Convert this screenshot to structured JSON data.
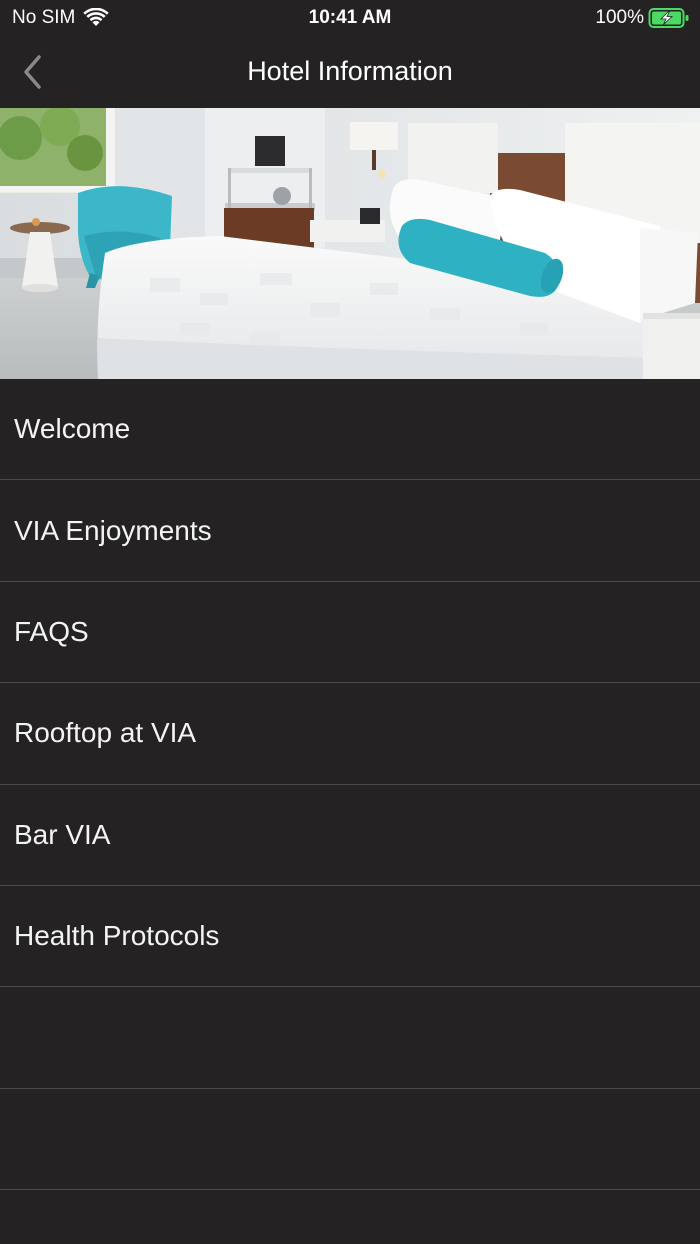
{
  "status_bar": {
    "carrier": "No SIM",
    "time": "10:41 AM",
    "battery_percent": "100%",
    "battery_level": 1.0,
    "charging": true,
    "icons": [
      "wifi-icon",
      "battery-charging-icon"
    ]
  },
  "nav": {
    "title": "Hotel Information",
    "back_icon": "chevron-left-icon"
  },
  "hero": {
    "image": "hotel-room-photo",
    "accent_color": "#2fb1c4"
  },
  "menu": {
    "items": [
      {
        "label": "Welcome"
      },
      {
        "label": "VIA Enjoyments"
      },
      {
        "label": "FAQS"
      },
      {
        "label": "Rooftop at VIA"
      },
      {
        "label": "Bar VIA"
      },
      {
        "label": "Health Protocols"
      }
    ]
  },
  "colors": {
    "background": "#242223",
    "divider": "#4a4849",
    "text": "#ffffff",
    "battery_green": "#4cd964"
  }
}
